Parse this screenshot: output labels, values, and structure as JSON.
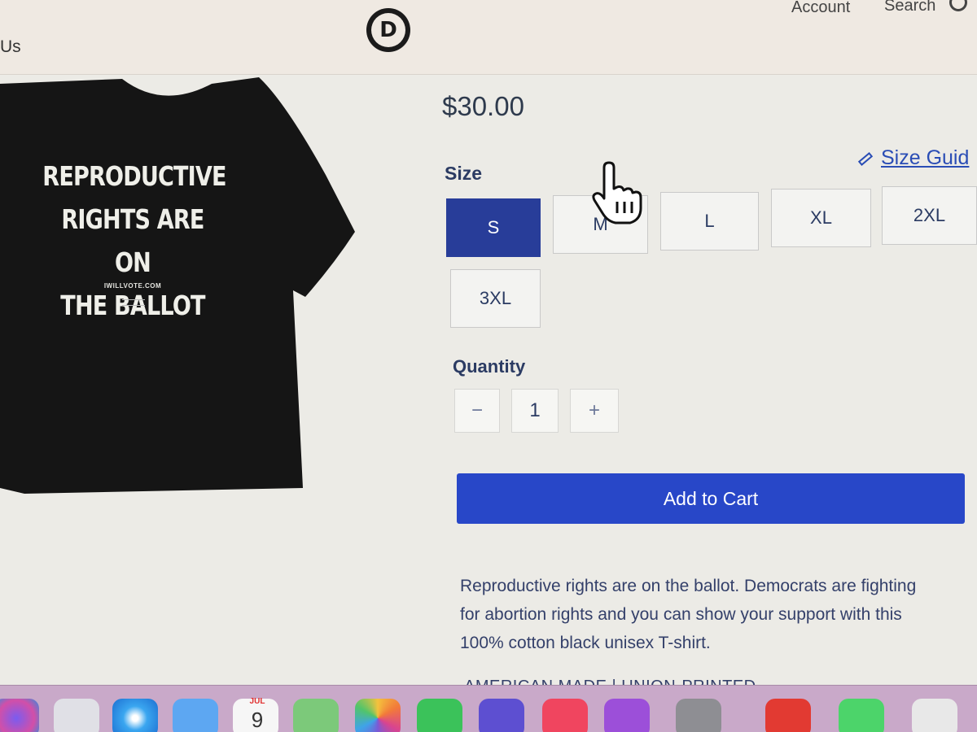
{
  "header": {
    "nav_left": "Us",
    "logo_letter": "D",
    "account_label": "Account",
    "search_label": "Search"
  },
  "product": {
    "image_text_lines": [
      "REPRODUCTIVE",
      "RIGHTS ARE ON",
      "THE BALLOT"
    ],
    "image_url_text": "IWILLVOTE.COM",
    "price": "$30.00",
    "size_label": "Size",
    "size_guide_label": "Size Guid",
    "sizes": [
      "S",
      "M",
      "L",
      "XL",
      "2XL",
      "3XL"
    ],
    "selected_size": "S",
    "quantity_label": "Quantity",
    "quantity_minus": "−",
    "quantity_value": "1",
    "quantity_plus": "+",
    "add_to_cart_label": "Add to Cart",
    "description": "Reproductive rights are on the ballot. Democrats are fighting for abortion rights and you can show your support with this 100% cotton black unisex T-shirt.",
    "made_note": "AMERICAN MADE | UNION-PRINTED"
  },
  "dock": {
    "calendar_month": "JUL",
    "calendar_day": "9",
    "icons": [
      "siri-icon",
      "launchpad-icon",
      "safari-icon",
      "mail-icon",
      "calendar-icon",
      "maps-icon",
      "photos-icon",
      "facetime-icon",
      "imovie-icon",
      "music-icon",
      "podcasts-icon",
      "settings-icon",
      "app-icon",
      "messages-icon",
      "app-icon-2"
    ],
    "colors": {
      "selected_size": "#283d99",
      "cart_button": "#2847c8",
      "link": "#2a4db5"
    }
  }
}
